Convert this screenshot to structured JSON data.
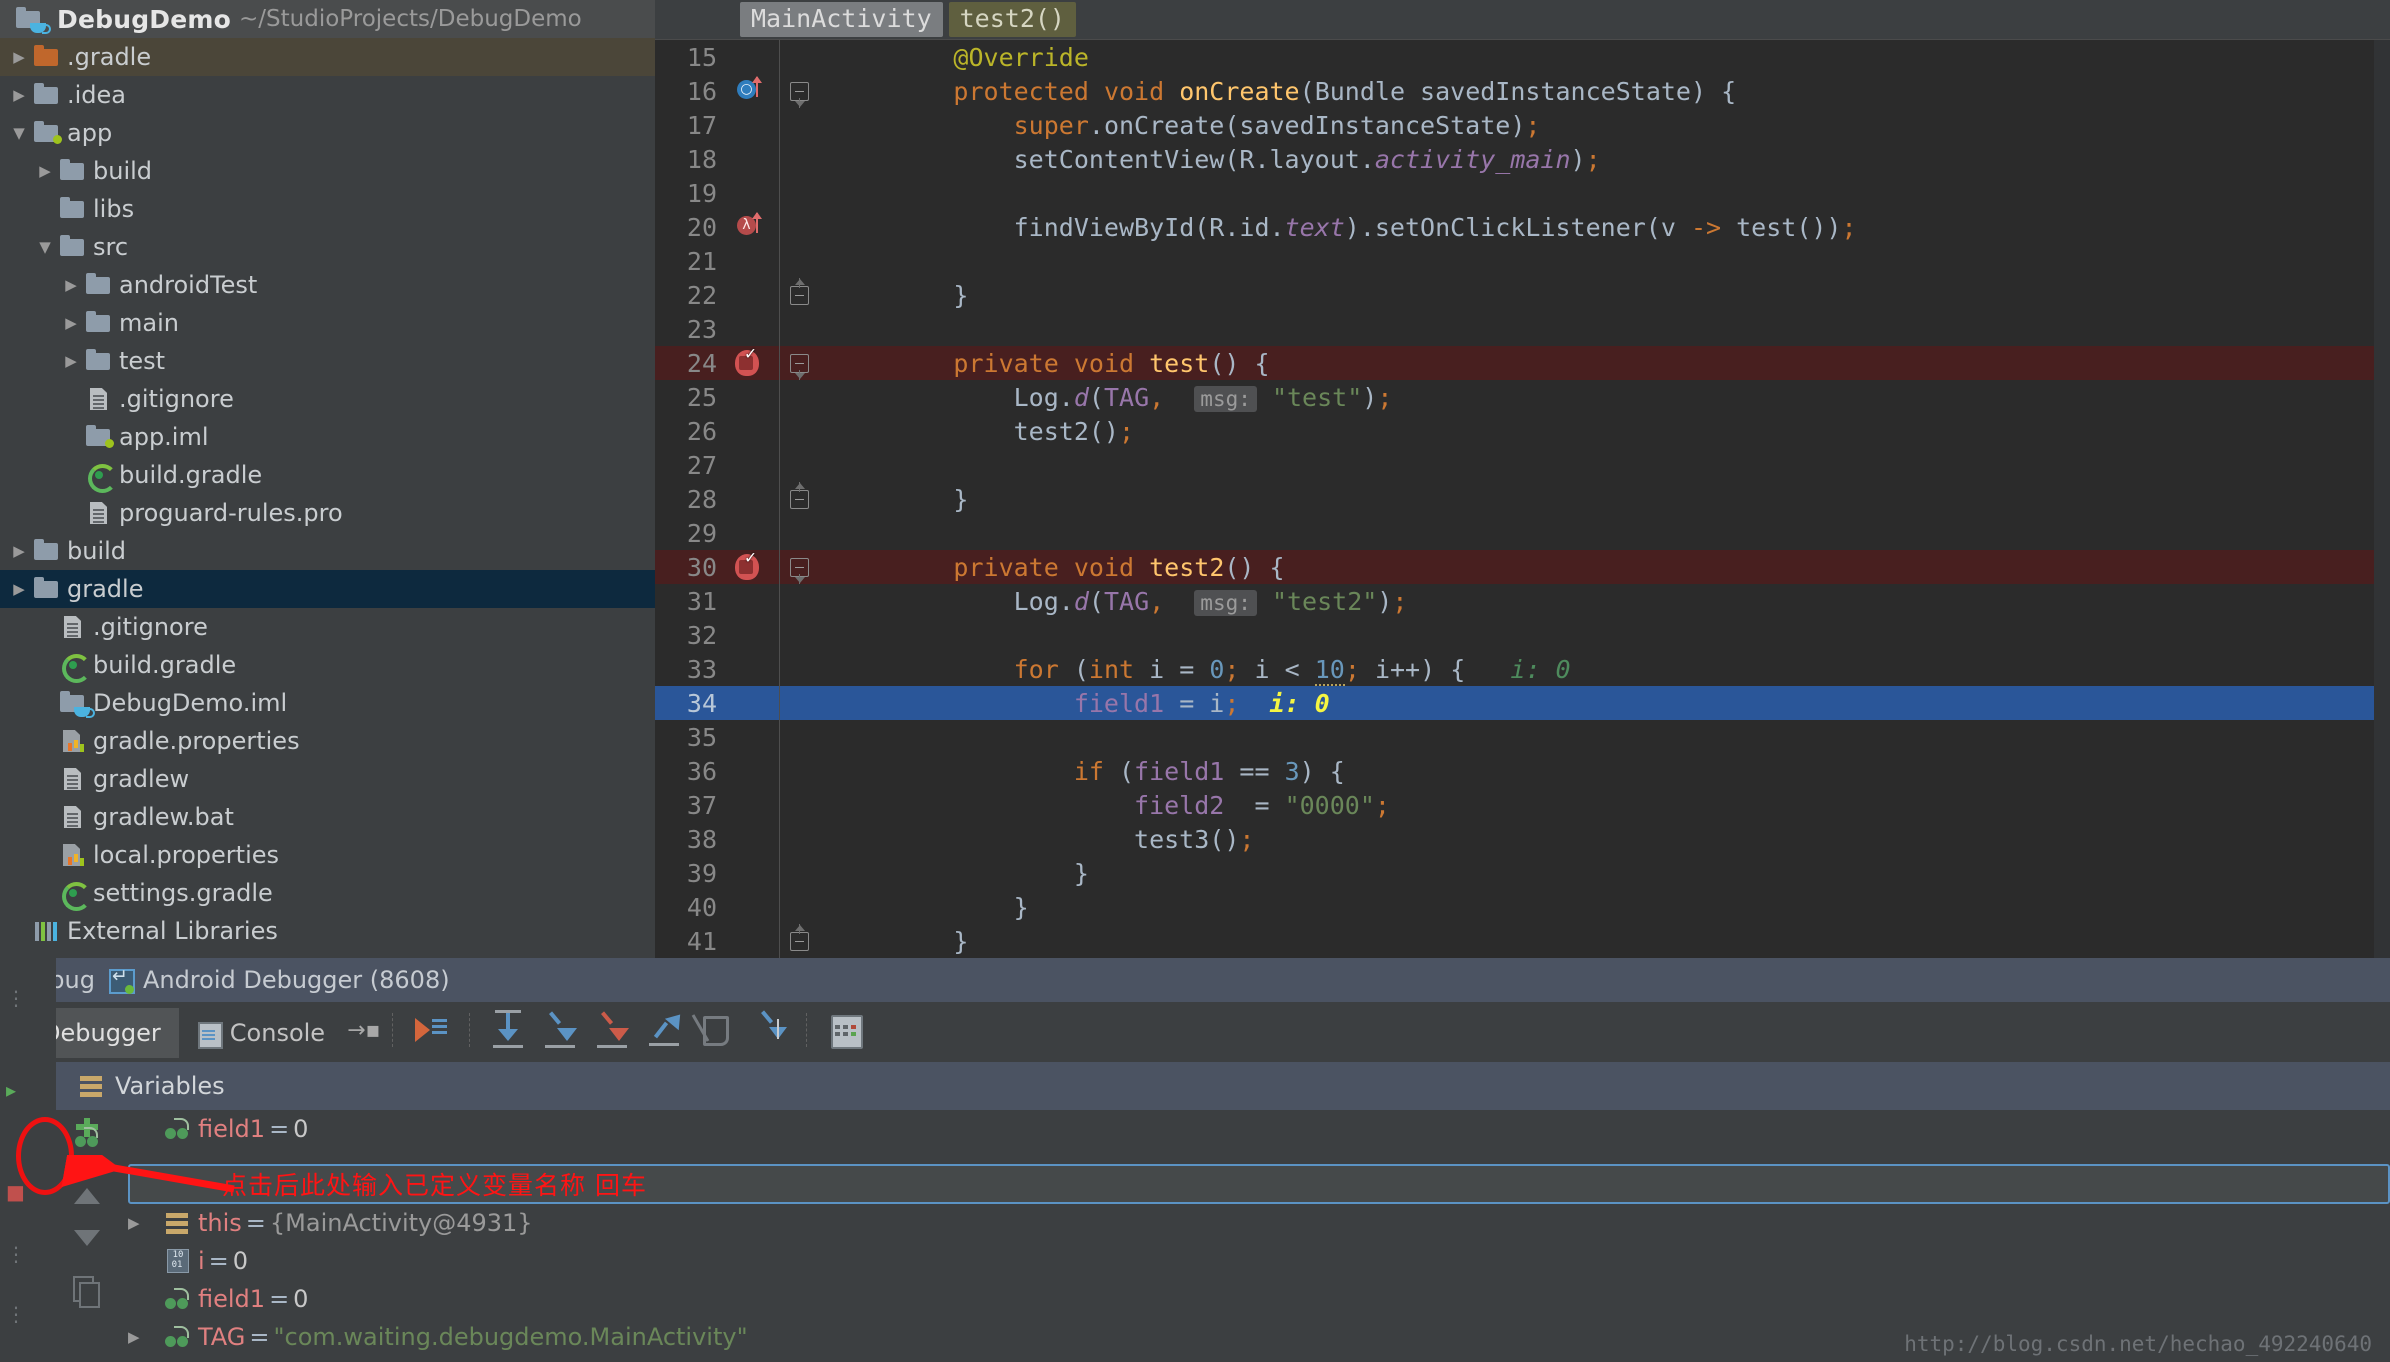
{
  "project": {
    "name": "DebugDemo",
    "path": "~/StudioProjects/DebugDemo",
    "icon": "module-icon",
    "tree": [
      {
        "label": ".gradle",
        "indent": 0,
        "twisty": "closed",
        "icon": "folder-orange-icon",
        "state": "sel-gray"
      },
      {
        "label": ".idea",
        "indent": 0,
        "twisty": "closed",
        "icon": "folder-icon",
        "state": ""
      },
      {
        "label": "app",
        "indent": 0,
        "twisty": "open",
        "icon": "module-icon",
        "state": ""
      },
      {
        "label": "build",
        "indent": 1,
        "twisty": "closed",
        "icon": "folder-icon",
        "state": ""
      },
      {
        "label": "libs",
        "indent": 1,
        "twisty": "none",
        "icon": "folder-icon",
        "state": ""
      },
      {
        "label": "src",
        "indent": 1,
        "twisty": "open",
        "icon": "folder-icon",
        "state": ""
      },
      {
        "label": "androidTest",
        "indent": 2,
        "twisty": "closed",
        "icon": "folder-icon",
        "state": ""
      },
      {
        "label": "main",
        "indent": 2,
        "twisty": "closed",
        "icon": "folder-icon",
        "state": ""
      },
      {
        "label": "test",
        "indent": 2,
        "twisty": "closed",
        "icon": "folder-icon",
        "state": ""
      },
      {
        "label": ".gitignore",
        "indent": 2,
        "twisty": "none",
        "icon": "file-icon",
        "state": ""
      },
      {
        "label": "app.iml",
        "indent": 2,
        "twisty": "none",
        "icon": "module-icon",
        "state": ""
      },
      {
        "label": "build.gradle",
        "indent": 2,
        "twisty": "none",
        "icon": "gradle-icon",
        "state": ""
      },
      {
        "label": "proguard-rules.pro",
        "indent": 2,
        "twisty": "none",
        "icon": "file-icon",
        "state": ""
      },
      {
        "label": "build",
        "indent": 0,
        "twisty": "closed",
        "icon": "folder-icon",
        "state": ""
      },
      {
        "label": "gradle",
        "indent": 0,
        "twisty": "closed",
        "icon": "folder-icon",
        "state": "sel-blue"
      },
      {
        "label": ".gitignore",
        "indent": 1,
        "twisty": "none",
        "icon": "file-icon",
        "state": ""
      },
      {
        "label": "build.gradle",
        "indent": 1,
        "twisty": "none",
        "icon": "gradle-icon",
        "state": ""
      },
      {
        "label": "DebugDemo.iml",
        "indent": 1,
        "twisty": "none",
        "icon": "module-icon",
        "state": ""
      },
      {
        "label": "gradle.properties",
        "indent": 1,
        "twisty": "none",
        "icon": "properties-icon",
        "state": ""
      },
      {
        "label": "gradlew",
        "indent": 1,
        "twisty": "none",
        "icon": "file-icon",
        "state": ""
      },
      {
        "label": "gradlew.bat",
        "indent": 1,
        "twisty": "none",
        "icon": "file-icon",
        "state": ""
      },
      {
        "label": "local.properties",
        "indent": 1,
        "twisty": "none",
        "icon": "properties-icon",
        "state": ""
      },
      {
        "label": "settings.gradle",
        "indent": 1,
        "twisty": "none",
        "icon": "gradle-icon",
        "state": ""
      },
      {
        "label": "External Libraries",
        "indent": 0,
        "twisty": "none",
        "icon": "external-libraries-icon",
        "state": ""
      }
    ]
  },
  "editor": {
    "breadcrumbs": [
      {
        "label": "MainActivity",
        "style": "c1"
      },
      {
        "label": "test2()",
        "style": "c2"
      }
    ],
    "lines": [
      {
        "n": "15",
        "mark": "",
        "fold": "",
        "row": "",
        "indent": 2,
        "tokens": [
          {
            "t": "@Override",
            "c": "ann"
          }
        ]
      },
      {
        "n": "16",
        "mark": "override",
        "fold": "start",
        "row": "",
        "indent": 2,
        "tokens": [
          {
            "t": "protected ",
            "c": "kw"
          },
          {
            "t": "void ",
            "c": "kw"
          },
          {
            "t": "onCreate",
            "c": "mth"
          },
          {
            "t": "(",
            "c": "pln"
          },
          {
            "t": "Bundle savedInstanceState",
            "c": "typ"
          },
          {
            "t": ") {",
            "c": "pln"
          }
        ]
      },
      {
        "n": "17",
        "mark": "",
        "fold": "",
        "row": "",
        "indent": 3,
        "tokens": [
          {
            "t": "super",
            "c": "kw"
          },
          {
            "t": ".onCreate(savedInstanceState)",
            "c": "typ"
          },
          {
            "t": ";",
            "c": "semi"
          }
        ]
      },
      {
        "n": "18",
        "mark": "",
        "fold": "",
        "row": "",
        "indent": 3,
        "tokens": [
          {
            "t": "setContentView(R.layout.",
            "c": "typ"
          },
          {
            "t": "activity_main",
            "c": "stat"
          },
          {
            "t": ")",
            "c": "typ"
          },
          {
            "t": ";",
            "c": "semi"
          }
        ]
      },
      {
        "n": "19",
        "mark": "",
        "fold": "",
        "row": "",
        "indent": 0,
        "tokens": []
      },
      {
        "n": "20",
        "mark": "lambda",
        "fold": "",
        "row": "",
        "indent": 3,
        "tokens": [
          {
            "t": "findViewById(R.id.",
            "c": "typ"
          },
          {
            "t": "text",
            "c": "stat"
          },
          {
            "t": ").setOnClickListener(v ",
            "c": "typ"
          },
          {
            "t": "->",
            "c": "kw"
          },
          {
            "t": " test())",
            "c": "typ"
          },
          {
            "t": ";",
            "c": "semi"
          }
        ]
      },
      {
        "n": "21",
        "mark": "",
        "fold": "",
        "row": "",
        "indent": 0,
        "tokens": []
      },
      {
        "n": "22",
        "mark": "",
        "fold": "end",
        "row": "",
        "indent": 2,
        "tokens": [
          {
            "t": "}",
            "c": "typ"
          }
        ]
      },
      {
        "n": "23",
        "mark": "",
        "fold": "",
        "row": "",
        "indent": 0,
        "tokens": []
      },
      {
        "n": "24",
        "mark": "breakpoint",
        "fold": "start",
        "row": "err-line",
        "indent": 2,
        "tokens": [
          {
            "t": "private ",
            "c": "kw"
          },
          {
            "t": "void ",
            "c": "kw"
          },
          {
            "t": "test",
            "c": "mth"
          },
          {
            "t": "() {",
            "c": "pln"
          }
        ]
      },
      {
        "n": "25",
        "mark": "",
        "fold": "",
        "row": "",
        "indent": 3,
        "tokens": [
          {
            "t": "Log.",
            "c": "typ"
          },
          {
            "t": "d",
            "c": "stat"
          },
          {
            "t": "(",
            "c": "typ"
          },
          {
            "t": "TAG",
            "c": "fld"
          },
          {
            "t": ",",
            "c": "semi"
          },
          {
            "t": "  ",
            "c": "pln"
          },
          {
            "t": "msg:",
            "c": "hintbox"
          },
          {
            "t": " ",
            "c": "pln"
          },
          {
            "t": "\"test\"",
            "c": "str"
          },
          {
            "t": ")",
            "c": "typ"
          },
          {
            "t": ";",
            "c": "semi"
          }
        ]
      },
      {
        "n": "26",
        "mark": "",
        "fold": "",
        "row": "",
        "indent": 3,
        "tokens": [
          {
            "t": "test2()",
            "c": "typ"
          },
          {
            "t": ";",
            "c": "semi"
          }
        ]
      },
      {
        "n": "27",
        "mark": "",
        "fold": "",
        "row": "",
        "indent": 0,
        "tokens": []
      },
      {
        "n": "28",
        "mark": "",
        "fold": "end",
        "row": "",
        "indent": 2,
        "tokens": [
          {
            "t": "}",
            "c": "typ"
          }
        ]
      },
      {
        "n": "29",
        "mark": "",
        "fold": "",
        "row": "",
        "indent": 0,
        "tokens": []
      },
      {
        "n": "30",
        "mark": "breakpoint",
        "fold": "start",
        "row": "err-line",
        "indent": 2,
        "tokens": [
          {
            "t": "private ",
            "c": "kw"
          },
          {
            "t": "void ",
            "c": "kw"
          },
          {
            "t": "test2",
            "c": "mth"
          },
          {
            "t": "() {",
            "c": "pln"
          }
        ]
      },
      {
        "n": "31",
        "mark": "",
        "fold": "",
        "row": "",
        "indent": 3,
        "tokens": [
          {
            "t": "Log.",
            "c": "typ"
          },
          {
            "t": "d",
            "c": "stat"
          },
          {
            "t": "(",
            "c": "typ"
          },
          {
            "t": "TAG",
            "c": "fld"
          },
          {
            "t": ",",
            "c": "semi"
          },
          {
            "t": "  ",
            "c": "pln"
          },
          {
            "t": "msg:",
            "c": "hintbox"
          },
          {
            "t": " ",
            "c": "pln"
          },
          {
            "t": "\"test2\"",
            "c": "str"
          },
          {
            "t": ")",
            "c": "typ"
          },
          {
            "t": ";",
            "c": "semi"
          }
        ]
      },
      {
        "n": "32",
        "mark": "",
        "fold": "",
        "row": "",
        "indent": 0,
        "tokens": []
      },
      {
        "n": "33",
        "mark": "",
        "fold": "",
        "row": "",
        "indent": 3,
        "tokens": [
          {
            "t": "for ",
            "c": "kw"
          },
          {
            "t": "(",
            "c": "pln"
          },
          {
            "t": "int",
            "c": "kw"
          },
          {
            "t": " i = ",
            "c": "typ"
          },
          {
            "t": "0",
            "c": "num"
          },
          {
            "t": ";",
            "c": "semi"
          },
          {
            "t": " i < ",
            "c": "typ"
          },
          {
            "t": "10",
            "c": "num squiggle"
          },
          {
            "t": ";",
            "c": "semi"
          },
          {
            "t": " i++) {",
            "c": "typ"
          },
          {
            "t": "   ",
            "c": "pln"
          },
          {
            "t": "i: 0",
            "c": "dbgval"
          }
        ]
      },
      {
        "n": "34",
        "mark": "",
        "fold": "",
        "row": "exec-line",
        "indent": 4,
        "tokens": [
          {
            "t": "field1",
            "c": "fld"
          },
          {
            "t": " = i",
            "c": "typ"
          },
          {
            "t": ";",
            "c": "semi"
          },
          {
            "t": "  ",
            "c": "pln"
          },
          {
            "t": "i: 0",
            "c": "dbgval-hl"
          }
        ]
      },
      {
        "n": "35",
        "mark": "",
        "fold": "",
        "row": "",
        "indent": 0,
        "tokens": []
      },
      {
        "n": "36",
        "mark": "",
        "fold": "",
        "row": "",
        "indent": 4,
        "tokens": [
          {
            "t": "if ",
            "c": "kw"
          },
          {
            "t": "(",
            "c": "pln"
          },
          {
            "t": "field1",
            "c": "fld"
          },
          {
            "t": " == ",
            "c": "typ"
          },
          {
            "t": "3",
            "c": "num"
          },
          {
            "t": ") {",
            "c": "pln"
          }
        ]
      },
      {
        "n": "37",
        "mark": "",
        "fold": "",
        "row": "",
        "indent": 5,
        "tokens": [
          {
            "t": "field2",
            "c": "fld"
          },
          {
            "t": "  = ",
            "c": "typ"
          },
          {
            "t": "\"0000\"",
            "c": "str"
          },
          {
            "t": ";",
            "c": "semi"
          }
        ]
      },
      {
        "n": "38",
        "mark": "",
        "fold": "",
        "row": "",
        "indent": 5,
        "tokens": [
          {
            "t": "test3()",
            "c": "typ"
          },
          {
            "t": ";",
            "c": "semi"
          }
        ]
      },
      {
        "n": "39",
        "mark": "",
        "fold": "",
        "row": "",
        "indent": 4,
        "tokens": [
          {
            "t": "}",
            "c": "typ"
          }
        ]
      },
      {
        "n": "40",
        "mark": "",
        "fold": "",
        "row": "",
        "indent": 3,
        "tokens": [
          {
            "t": "}",
            "c": "typ"
          }
        ]
      },
      {
        "n": "41",
        "mark": "",
        "fold": "end",
        "row": "",
        "indent": 2,
        "tokens": [
          {
            "t": "}",
            "c": "typ"
          }
        ]
      }
    ]
  },
  "debug": {
    "window_label": "Debug",
    "session_title": "Android Debugger (8608)",
    "session_icon": "android-debugger-icon",
    "tabs": [
      {
        "label": "Debugger",
        "icon": "",
        "active": true
      },
      {
        "label": "Console",
        "icon": "console-icon",
        "active": false
      }
    ],
    "pin_icon": "pin-tab-icon",
    "toolbar_buttons": [
      {
        "name": "resume-program-button",
        "icon": "resume-icon"
      },
      {
        "name": "step-over-button",
        "icon": "step-over-icon"
      },
      {
        "name": "step-into-button",
        "icon": "step-into-icon"
      },
      {
        "name": "force-step-into-button",
        "icon": "force-step-into-icon"
      },
      {
        "name": "step-out-button",
        "icon": "step-out-icon"
      },
      {
        "name": "drop-frame-button",
        "icon": "drop-frame-icon"
      },
      {
        "name": "run-to-cursor-button",
        "icon": "run-to-cursor-icon"
      },
      {
        "name": "evaluate-expression-button",
        "icon": "evaluate-expression-icon"
      }
    ]
  },
  "variables": {
    "header": "Variables",
    "header_icon": "variables-icon",
    "gutter_buttons": [
      {
        "name": "add-watch-button",
        "icon": "add-watch-icon"
      },
      {
        "name": "remove-watch-button",
        "icon": "remove-watch-icon"
      },
      {
        "name": "move-up-button",
        "icon": "arrow-up-icon"
      },
      {
        "name": "move-down-button",
        "icon": "arrow-down-icon"
      },
      {
        "name": "copy-value-button",
        "icon": "copy-icon"
      }
    ],
    "new_watch_input": {
      "value": "",
      "placeholder": ""
    },
    "rows": [
      {
        "twisty": "none",
        "icon": "field-icon",
        "name": "field1",
        "eq": "=",
        "value": "0",
        "vclass": "vnum"
      },
      {
        "twisty": "closed",
        "icon": "object-icon",
        "name": "this",
        "eq": "=",
        "value": "{MainActivity@4931}",
        "vclass": "vobj"
      },
      {
        "twisty": "none",
        "icon": "primitive-icon",
        "name": "i",
        "eq": "=",
        "value": "0",
        "vclass": "vnum"
      },
      {
        "twisty": "none",
        "icon": "field-icon",
        "name": "field1",
        "eq": "=",
        "value": "0",
        "vclass": "vnum"
      },
      {
        "twisty": "closed",
        "icon": "field-icon",
        "name": "TAG",
        "eq": "=",
        "value": "\"com.waiting.debugdemo.MainActivity\"",
        "vclass": "vstr"
      }
    ]
  },
  "annotation": {
    "text": "点击后此处输入已定义变量名称 回车",
    "color": "#ff1414",
    "highlight_shape": "ellipse",
    "arrow": "left-pointing-arrow"
  },
  "watermark": "http://blog.csdn.net/hechao_492240640",
  "colors": {
    "editor_bg": "#2b2b2b",
    "panel_bg": "#3c3f41",
    "exec_line": "#2a5699",
    "breakpoint_line": "#481f1f",
    "tree_selected": "#0d293e",
    "debug_title_bg": "#4b5362",
    "annotation_red": "#ff1414"
  }
}
